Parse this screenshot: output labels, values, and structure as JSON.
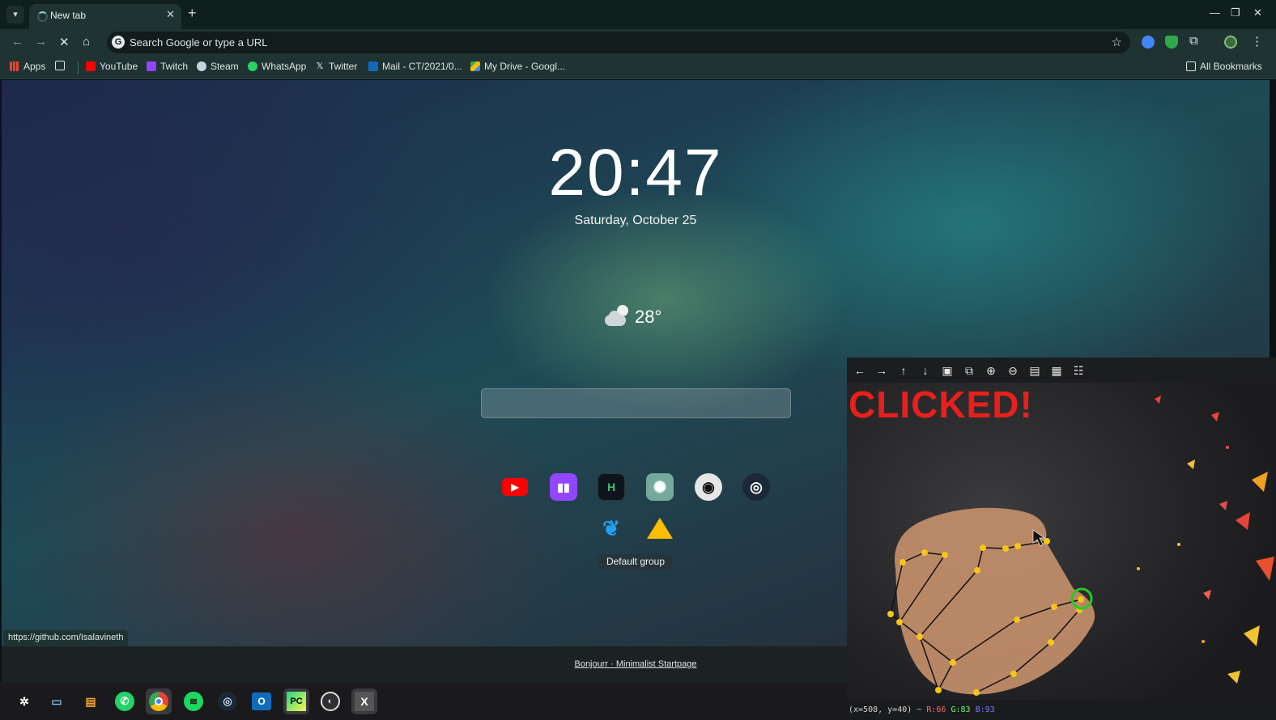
{
  "tab": {
    "title": "New tab"
  },
  "toolbar": {
    "omnibox_text": "Search Google or type a URL"
  },
  "bookmarks": {
    "items": [
      {
        "label": "Apps",
        "color": "#ea4335"
      },
      {
        "label": "YouTube",
        "color": "#ff0000"
      },
      {
        "label": "Twitch",
        "color": "#9146ff"
      },
      {
        "label": "Steam",
        "color": "#c7d5e0"
      },
      {
        "label": "WhatsApp",
        "color": "#25d366"
      },
      {
        "label": "Twitter",
        "color": "#ffffff"
      },
      {
        "label": "Mail - CT/2021/0...",
        "color": "#0f6cbd"
      },
      {
        "label": "My Drive - Googl...",
        "color": "#34a853"
      }
    ],
    "all_bookmarks": "All Bookmarks"
  },
  "page": {
    "clock": "20:47",
    "date": "Saturday, October 25",
    "temperature": "28°",
    "weather_icon": "cloudy-night-icon",
    "group_label": "Default group",
    "status_url": "https://github.com/Isalavineth",
    "footer_link": "Bonjourr · Minimalist Startpage"
  },
  "shortcuts": [
    {
      "name": "youtube",
      "glyph": "▶",
      "bg": "#ff0000",
      "fg": "#ffffff"
    },
    {
      "name": "twitch",
      "glyph": "◫",
      "bg": "#9146ff",
      "fg": "#ffffff"
    },
    {
      "name": "hackerrank",
      "glyph": "H",
      "bg": "#0e141e",
      "fg": "#2ec866"
    },
    {
      "name": "chatgpt",
      "glyph": "✺",
      "bg": "#74aa9c",
      "fg": "#ffffff"
    },
    {
      "name": "github",
      "glyph": "◉",
      "bg": "#e6e6e6",
      "fg": "#111111"
    },
    {
      "name": "steam",
      "glyph": "◎",
      "bg": "#1b2838",
      "fg": "#ffffff"
    },
    {
      "name": "twitter",
      "glyph": "🐦",
      "bg": "transparent",
      "fg": "#1da1f2"
    },
    {
      "name": "google-drive",
      "glyph": "▲",
      "bg": "transparent",
      "fg": "#fbbc04"
    }
  ],
  "camera": {
    "overlay_text": "CLICKED!",
    "status_coords": "(x=508, y=40) ~",
    "status_r": "R:66",
    "status_g": "G:83",
    "status_b": "B:93"
  },
  "colors": {
    "accent": "#1f3432",
    "clicked": "#e8201c",
    "landmark": "#f5c518",
    "highlight": "#22cc22"
  }
}
